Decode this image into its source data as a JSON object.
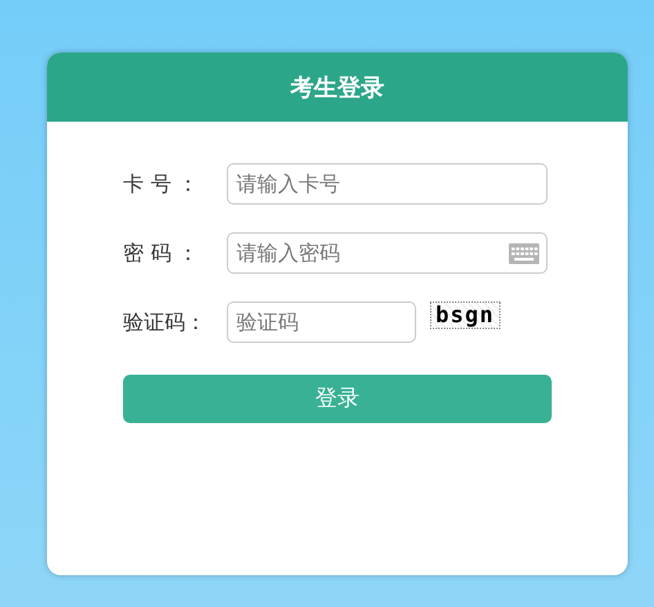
{
  "title": "考生登录",
  "fields": [
    {
      "kind": "text",
      "label": "卡 号 ：",
      "placeholder": "请输入卡号"
    },
    {
      "kind": "password",
      "label": "密 码 ：",
      "placeholder": "请输入密码"
    },
    {
      "kind": "captcha",
      "label": "验证码：",
      "placeholder": "验证码",
      "captcha": "bsgn"
    }
  ],
  "button": "登录"
}
